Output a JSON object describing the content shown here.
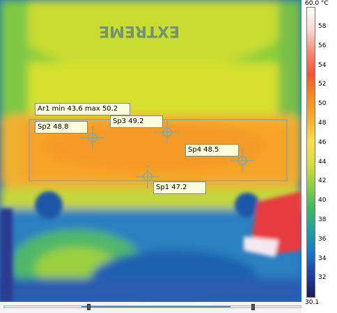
{
  "image": {
    "brand_text": "EXTREME",
    "palette": "rainbow"
  },
  "measurements": {
    "area": {
      "name": "Ar1",
      "text": "Ar1 min 43.6 max 50.2"
    },
    "spots": [
      {
        "name": "Sp2",
        "text": "Sp2 48.8"
      },
      {
        "name": "Sp3",
        "text": "Sp3 49.2"
      },
      {
        "name": "Sp4",
        "text": "Sp4 48.5"
      },
      {
        "name": "Sp1",
        "text": "Sp1 47.2"
      }
    ]
  },
  "scale": {
    "max_label": "60.0 °C",
    "min_label": "30.1",
    "ticks": [
      "58",
      "56",
      "54",
      "52",
      "50",
      "48",
      "46",
      "44",
      "42",
      "40",
      "38",
      "36",
      "34",
      "32"
    ],
    "colors": [
      "#ffffff",
      "#ffd6d0",
      "#ff8a70",
      "#ff5030",
      "#ff8c1a",
      "#ffb020",
      "#ffe040",
      "#d8e030",
      "#8cd040",
      "#40b860",
      "#20a0a0",
      "#1878c8",
      "#2040a0",
      "#1a1a60"
    ]
  },
  "slider": {
    "range_start": 0.26,
    "range_end": 0.76
  }
}
